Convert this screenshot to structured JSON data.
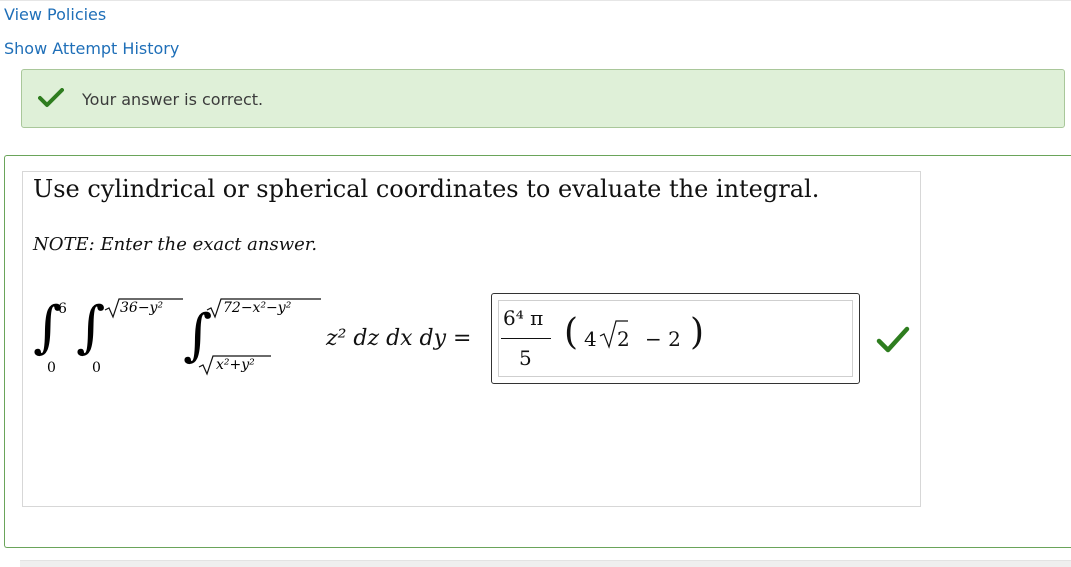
{
  "links": {
    "view_policies": "View Policies",
    "show_attempt_history": "Show Attempt History"
  },
  "alert": {
    "message": "Your answer is correct.",
    "icon": "check-icon",
    "color_bg": "#dff0d8",
    "color_icon": "#2e7d1f"
  },
  "problem": {
    "question": "Use cylindrical or spherical coordinates to evaluate the integral.",
    "note": "NOTE: Enter the exact answer.",
    "integral": {
      "outer_lower": "0",
      "outer_upper": "6",
      "middle_lower": "0",
      "middle_upper_radicand": "36−y²",
      "inner_lower_radicand": "x²+y²",
      "inner_upper_radicand": "72−x²−y²",
      "integrand": "z² dz dx dy ="
    },
    "answer": {
      "numerator": "6⁴ π",
      "denominator": "5",
      "factor_open": "(",
      "factor_4": "4",
      "sqrt_radicand": "2",
      "minus_2": "− 2",
      "factor_close": ")"
    },
    "answer_status_icon": "check-icon",
    "answer_status_color": "#2e7d1f"
  }
}
